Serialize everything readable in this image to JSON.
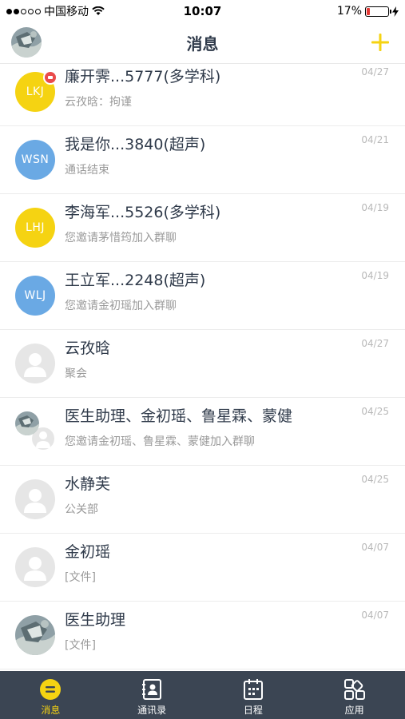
{
  "status_bar": {
    "carrier": "中国移动",
    "time": "10:07",
    "battery": "17%",
    "battery_level": 0.17
  },
  "header": {
    "title": "消息"
  },
  "chats": [
    {
      "name": "廉开霁...5777(多学科)",
      "preview": "云孜晗：拘谨",
      "date": "04/27",
      "avatar_text": "LKJ",
      "avatar_color": "#f5d312",
      "has_badge": true
    },
    {
      "name": "我是你...3840(超声)",
      "preview": "通话结束",
      "date": "04/21",
      "avatar_text": "WSN",
      "avatar_color": "#6aa9e4"
    },
    {
      "name": "李海军...5526(多学科)",
      "preview": "您邀请茅惜筠加入群聊",
      "date": "04/19",
      "avatar_text": "LHJ",
      "avatar_color": "#f5d312"
    },
    {
      "name": "王立军...2248(超声)",
      "preview": "您邀请金初瑶加入群聊",
      "date": "04/19",
      "avatar_text": "WLJ",
      "avatar_color": "#6aa9e4"
    },
    {
      "name": "云孜晗",
      "preview": "聚会",
      "date": "04/27"
    },
    {
      "name": "医生助理、金初瑶、鲁星霖、蒙健",
      "preview": "您邀请金初瑶、鲁星霖、蒙健加入群聊",
      "date": "04/25"
    },
    {
      "name": "水静芙",
      "preview": "公关部",
      "date": "04/25"
    },
    {
      "name": "金初瑶",
      "preview": "[文件]",
      "date": "04/07"
    },
    {
      "name": "医生助理",
      "preview": "[文件]",
      "date": "04/07"
    }
  ],
  "tabs": [
    {
      "label": "消息",
      "icon": "message-icon",
      "active": true
    },
    {
      "label": "通讯录",
      "icon": "contacts-icon"
    },
    {
      "label": "日程",
      "icon": "calendar-icon"
    },
    {
      "label": "应用",
      "icon": "apps-icon"
    }
  ],
  "colors": {
    "accent": "#f5d312",
    "tabbar": "#3b4553",
    "badge": "#ea4b4b",
    "blue_avatar": "#6aa9e4"
  }
}
